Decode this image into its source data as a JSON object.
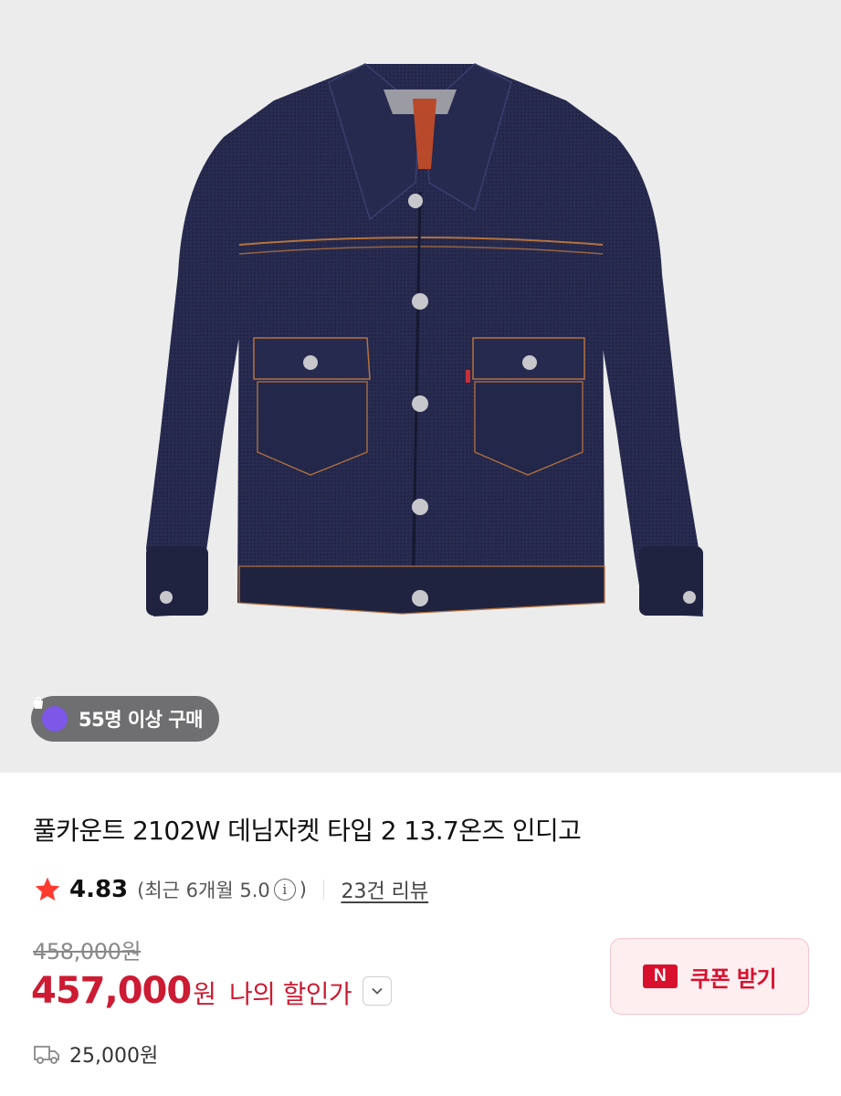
{
  "hero": {
    "image_alt": "indigo denim jacket product photo",
    "buyer_badge": {
      "icon": "shopping-bag-icon",
      "text": "55명 이상 구매",
      "icon_color": "#7d57e8"
    }
  },
  "product": {
    "title": "풀카운트 2102W 데님자켓 타입 2 13.7온즈 인디고",
    "rating": {
      "star_icon": "star-icon",
      "score": "4.83",
      "recent_open": "(최근 6개월 5.0",
      "recent_close": ")",
      "info_icon": "info-icon",
      "review_link": "23건 리뷰"
    },
    "original_price": "458,000원",
    "price": "457,000",
    "price_unit": "원",
    "my_price_label": "나의 할인가",
    "coupon": {
      "icon_text": "N",
      "label": "쿠폰 받기",
      "accent": "#d8102e"
    },
    "shipping": {
      "icon": "truck-icon",
      "text": "25,000원"
    }
  },
  "colors": {
    "price_red": "#cc1b32",
    "badge_purple": "#7d57e8"
  }
}
